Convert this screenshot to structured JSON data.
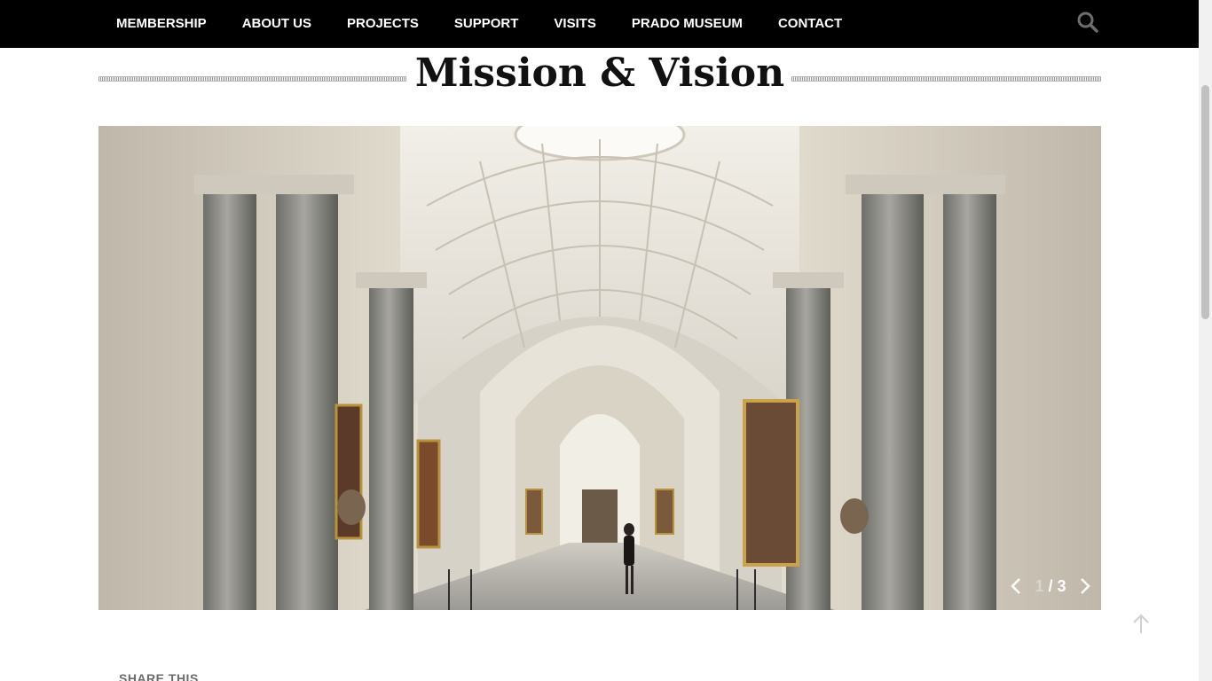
{
  "nav": {
    "items": [
      {
        "label": "MEMBERSHIP"
      },
      {
        "label": "ABOUT US"
      },
      {
        "label": "PROJECTS"
      },
      {
        "label": "SUPPORT"
      },
      {
        "label": "VISITS"
      },
      {
        "label": "PRADO MUSEUM"
      },
      {
        "label": "CONTACT"
      }
    ],
    "search_icon": "search-icon"
  },
  "page": {
    "title": "Mission & Vision"
  },
  "slider": {
    "current": "1",
    "separator": " / ",
    "total": "3",
    "prev_icon": "chevron-left-icon",
    "next_icon": "chevron-right-icon"
  },
  "share": {
    "label": "SHARE THIS"
  },
  "back_to_top_icon": "arrow-up-icon",
  "colors": {
    "nav_bg": "#000000",
    "nav_text": "#ffffff",
    "title_text": "#111111"
  }
}
